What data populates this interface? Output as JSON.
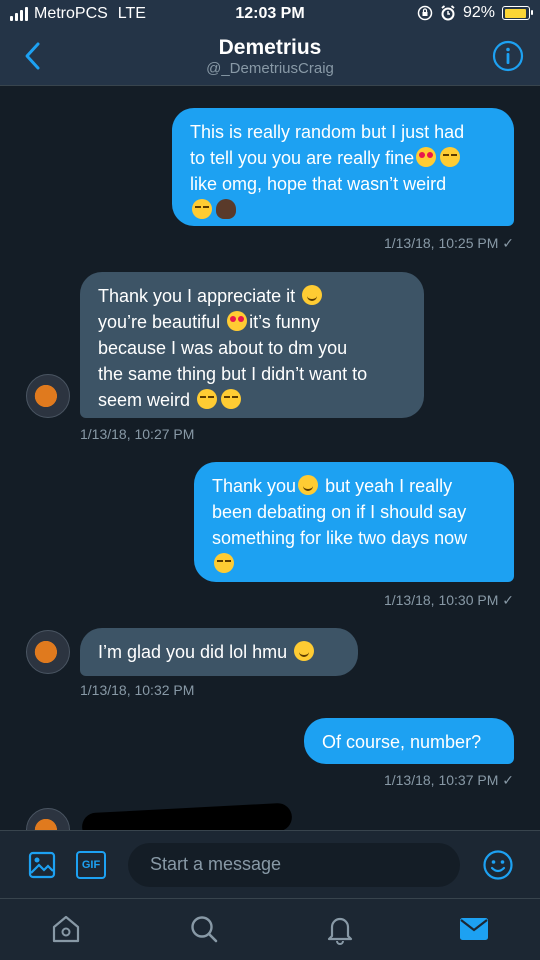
{
  "status_bar": {
    "carrier": "MetroPCS",
    "network": "LTE",
    "time": "12:03 PM",
    "battery": "92%",
    "battery_level": 0.92
  },
  "header": {
    "name": "Demetrius",
    "handle": "@_DemetriusCraig"
  },
  "messages": [
    {
      "direction": "sent",
      "lines": [
        "This is really random but I just had",
        "to tell you you are really fine",
        "like omg, hope that wasn’t weird"
      ],
      "timestamp": "1/13/18, 10:25 PM ✓"
    },
    {
      "direction": "received",
      "lines": [
        "Thank you I appreciate it",
        "you’re beautiful",
        "it’s funny",
        "because I was about to dm you",
        "the same thing but I didn’t want to",
        "seem weird"
      ],
      "timestamp": "1/13/18, 10:27 PM"
    },
    {
      "direction": "sent",
      "lines": [
        "Thank you",
        "but yeah I really",
        "been debating on if I should say",
        "something for like two days now"
      ],
      "timestamp": "1/13/18, 10:30 PM ✓"
    },
    {
      "direction": "received",
      "lines": [
        "I’m glad you did lol hmu"
      ],
      "timestamp": "1/13/18, 10:32 PM"
    },
    {
      "direction": "sent",
      "lines": [
        "Of course, number?"
      ],
      "timestamp": "1/13/18, 10:37 PM ✓"
    }
  ],
  "composer": {
    "placeholder": "Start a message",
    "gif_label": "GIF"
  },
  "colors": {
    "background": "#141d26",
    "bar": "#243447",
    "accent": "#1da1f2",
    "received_bubble": "#3d5466",
    "muted": "#8899a6"
  },
  "icons": {
    "back": "chevron-left-icon",
    "info": "info-icon",
    "photo": "image-icon",
    "gif": "gif-icon",
    "emoji": "smiley-icon",
    "home": "home-icon",
    "search": "search-icon",
    "notifications": "bell-icon",
    "messages": "mail-icon"
  }
}
